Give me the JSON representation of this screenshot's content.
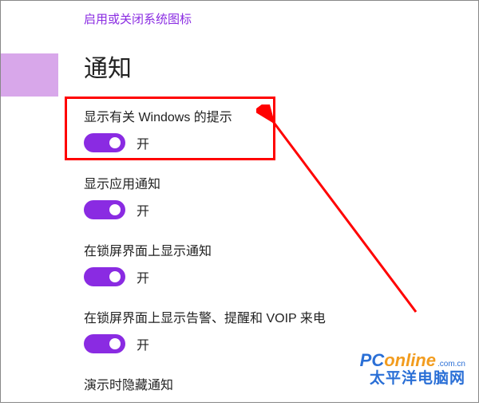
{
  "top_link": "启用或关闭系统图标",
  "section_title": "通知",
  "toggle_on_label": "开",
  "settings": [
    {
      "label": "显示有关 Windows 的提示",
      "state": "开"
    },
    {
      "label": "显示应用通知",
      "state": "开"
    },
    {
      "label": "在锁屏界面上显示通知",
      "state": "开"
    },
    {
      "label": "在锁屏界面上显示告警、提醒和 VOIP 来电",
      "state": "开"
    },
    {
      "label": "演示时隐藏通知",
      "state": ""
    }
  ],
  "watermark": {
    "brand_p": "PC",
    "brand_online": "online",
    "brand_suffix": ".com.cn",
    "tagline": "太平洋电脑网"
  }
}
